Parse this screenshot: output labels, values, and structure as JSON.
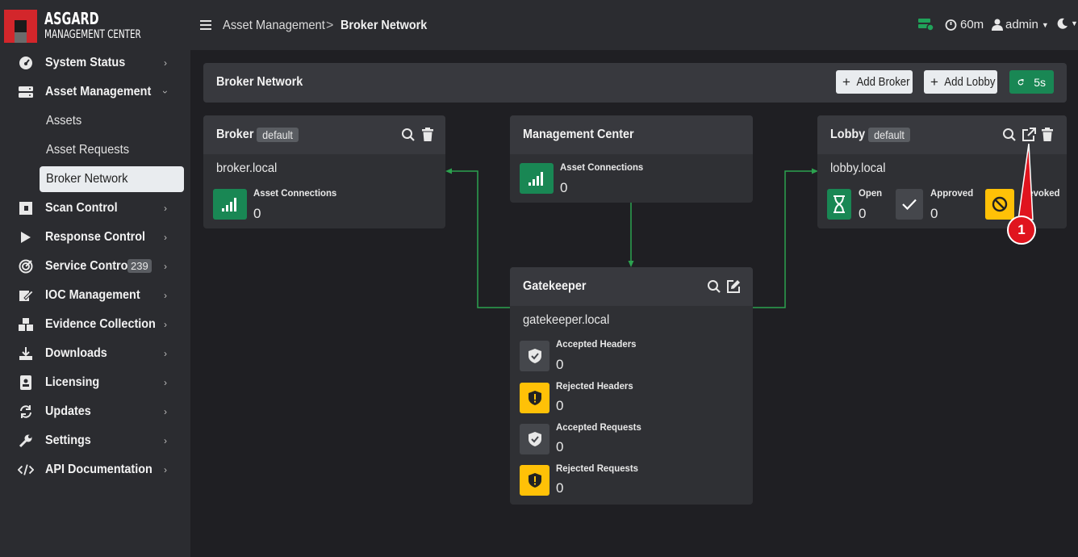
{
  "brand": {
    "title": "ASGARD",
    "subtitle": "MANAGEMENT CENTER"
  },
  "sidebar": {
    "items": [
      {
        "label": "System Status",
        "icon": "gauge-icon"
      },
      {
        "label": "Asset Management",
        "icon": "server-icon"
      },
      {
        "label": "Scan Control",
        "icon": "scan-icon"
      },
      {
        "label": "Response Control",
        "icon": "play-icon"
      },
      {
        "label": "Service Control",
        "icon": "target-icon",
        "badge": "239"
      },
      {
        "label": "IOC Management",
        "icon": "ioc-icon"
      },
      {
        "label": "Evidence Collection",
        "icon": "boxes-icon"
      },
      {
        "label": "Downloads",
        "icon": "download-icon"
      },
      {
        "label": "Licensing",
        "icon": "id-card-icon"
      },
      {
        "label": "Updates",
        "icon": "sync-icon"
      },
      {
        "label": "Settings",
        "icon": "wrench-icon"
      },
      {
        "label": "API Documentation",
        "icon": "code-icon"
      }
    ],
    "asset_sub": [
      {
        "label": "Assets"
      },
      {
        "label": "Asset Requests"
      },
      {
        "label": "Broker Network"
      }
    ]
  },
  "topbar": {
    "breadcrumb_parent": "Asset Management",
    "breadcrumb_sep": ">",
    "breadcrumb_current": "Broker Network",
    "session_time": "60m",
    "user": "admin"
  },
  "header": {
    "title": "Broker Network",
    "add_broker": "Add Broker",
    "add_lobby": "Add Lobby",
    "refresh": "5s"
  },
  "broker": {
    "title": "Broker",
    "tag": "default",
    "host": "broker.local",
    "stat_label": "Asset Connections",
    "stat_value": "0"
  },
  "mc": {
    "title": "Management Center",
    "stat_label": "Asset Connections",
    "stat_value": "0"
  },
  "lobby": {
    "title": "Lobby",
    "tag": "default",
    "host": "lobby.local",
    "open_label": "Open",
    "open_value": "0",
    "approved_label": "Approved",
    "approved_value": "0",
    "revoked_label": "Revoked",
    "revoked_value": "0"
  },
  "gatekeeper": {
    "title": "Gatekeeper",
    "host": "gatekeeper.local",
    "stats": [
      {
        "label": "Accepted Headers",
        "value": "0"
      },
      {
        "label": "Rejected Headers",
        "value": "0"
      },
      {
        "label": "Accepted Requests",
        "value": "0"
      },
      {
        "label": "Rejected Requests",
        "value": "0"
      }
    ]
  },
  "annotation": {
    "number": "1"
  },
  "colors": {
    "accent_green": "#198754",
    "warning_yellow": "#ffc107",
    "annotation_red": "#e0141e"
  }
}
